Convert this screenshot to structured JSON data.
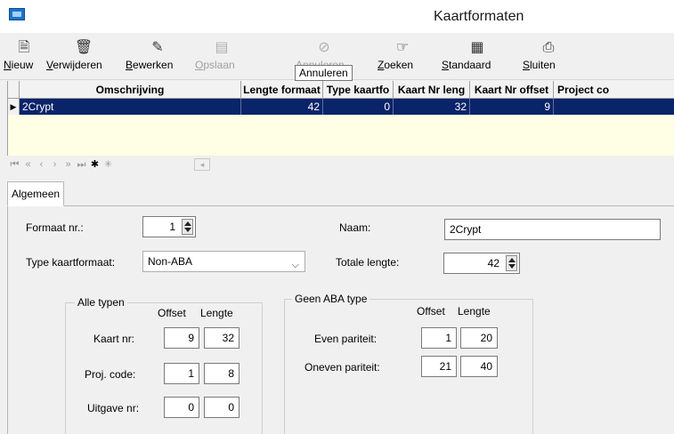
{
  "window": {
    "title": "Kaartformaten"
  },
  "toolbar": {
    "buttons": [
      {
        "label": "Nieuw",
        "icon": "new-doc-icon"
      },
      {
        "label": "Verwijderen",
        "icon": "trash-icon"
      },
      {
        "label": "Bewerken",
        "icon": "edit-icon"
      },
      {
        "label": "Opslaan",
        "icon": "save-icon"
      },
      {
        "label": "Annuleren",
        "icon": "cancel-icon"
      },
      {
        "label": "Zoeken",
        "icon": "search-hand-icon"
      },
      {
        "label": "Standaard",
        "icon": "default-icon"
      },
      {
        "label": "Sluiten",
        "icon": "close-door-icon"
      }
    ],
    "tooltip": "Annuleren"
  },
  "grid": {
    "columns": [
      "Omschrijving",
      "Lengte formaat",
      "Type kaartfo",
      "Kaart Nr leng",
      "Kaart Nr offset",
      "Project co"
    ],
    "rows": [
      {
        "omschrijving": "2Crypt",
        "lengte": "42",
        "type": "0",
        "kaartnr_lengte": "32",
        "kaartnr_offset": "9",
        "project": ""
      }
    ]
  },
  "navigator": {
    "buttons": [
      "first",
      "prior-page",
      "prior",
      "next",
      "next-page",
      "last",
      "insert",
      "delete"
    ]
  },
  "tabs": [
    {
      "label": "Algemeen"
    }
  ],
  "form": {
    "formaat_nr_label": "Formaat nr.:",
    "formaat_nr_value": "1",
    "naam_label": "Naam:",
    "naam_value": "2Crypt",
    "type_label": "Type kaartformaat:",
    "type_value": "Non-ABA",
    "totale_lengte_label": "Totale lengte:",
    "totale_lengte_value": "42",
    "alle_typen": {
      "title": "Alle typen",
      "offset_header": "Offset",
      "lengte_header": "Lengte",
      "rows": [
        {
          "label": "Kaart nr:",
          "offset": "9",
          "lengte": "32"
        },
        {
          "label": "Proj. code:",
          "offset": "1",
          "lengte": "8"
        },
        {
          "label": "Uitgave nr:",
          "offset": "0",
          "lengte": "0"
        }
      ]
    },
    "geen_aba": {
      "title": "Geen ABA type",
      "offset_header": "Offset",
      "lengte_header": "Lengte",
      "rows": [
        {
          "label": "Even pariteit:",
          "offset": "1",
          "lengte": "20"
        },
        {
          "label": "Oneven pariteit:",
          "offset": "21",
          "lengte": "40"
        }
      ]
    }
  }
}
